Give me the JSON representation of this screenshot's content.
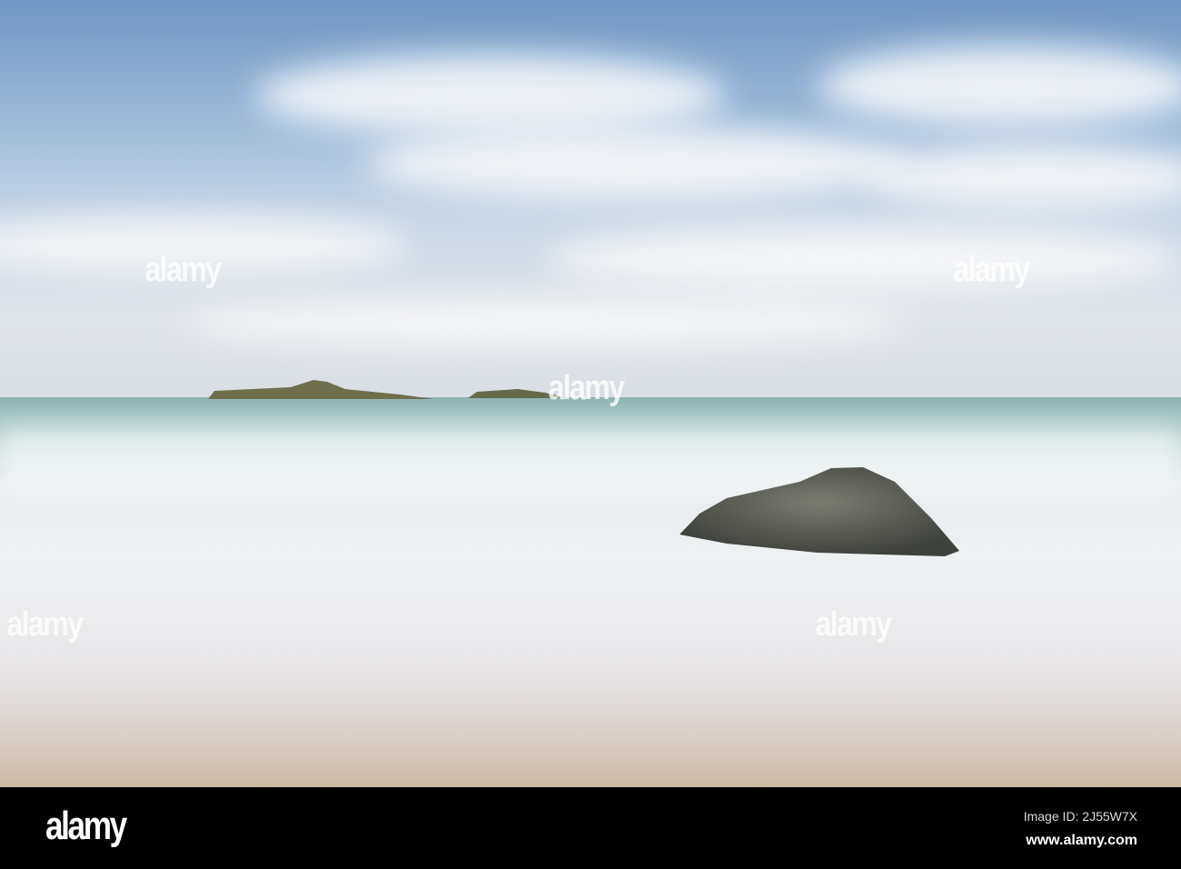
{
  "watermark": {
    "text": "alamy"
  },
  "footer": {
    "logo": "alamy",
    "image_id": "Image ID: 2J55W7X",
    "website": "www.alamy.com"
  }
}
